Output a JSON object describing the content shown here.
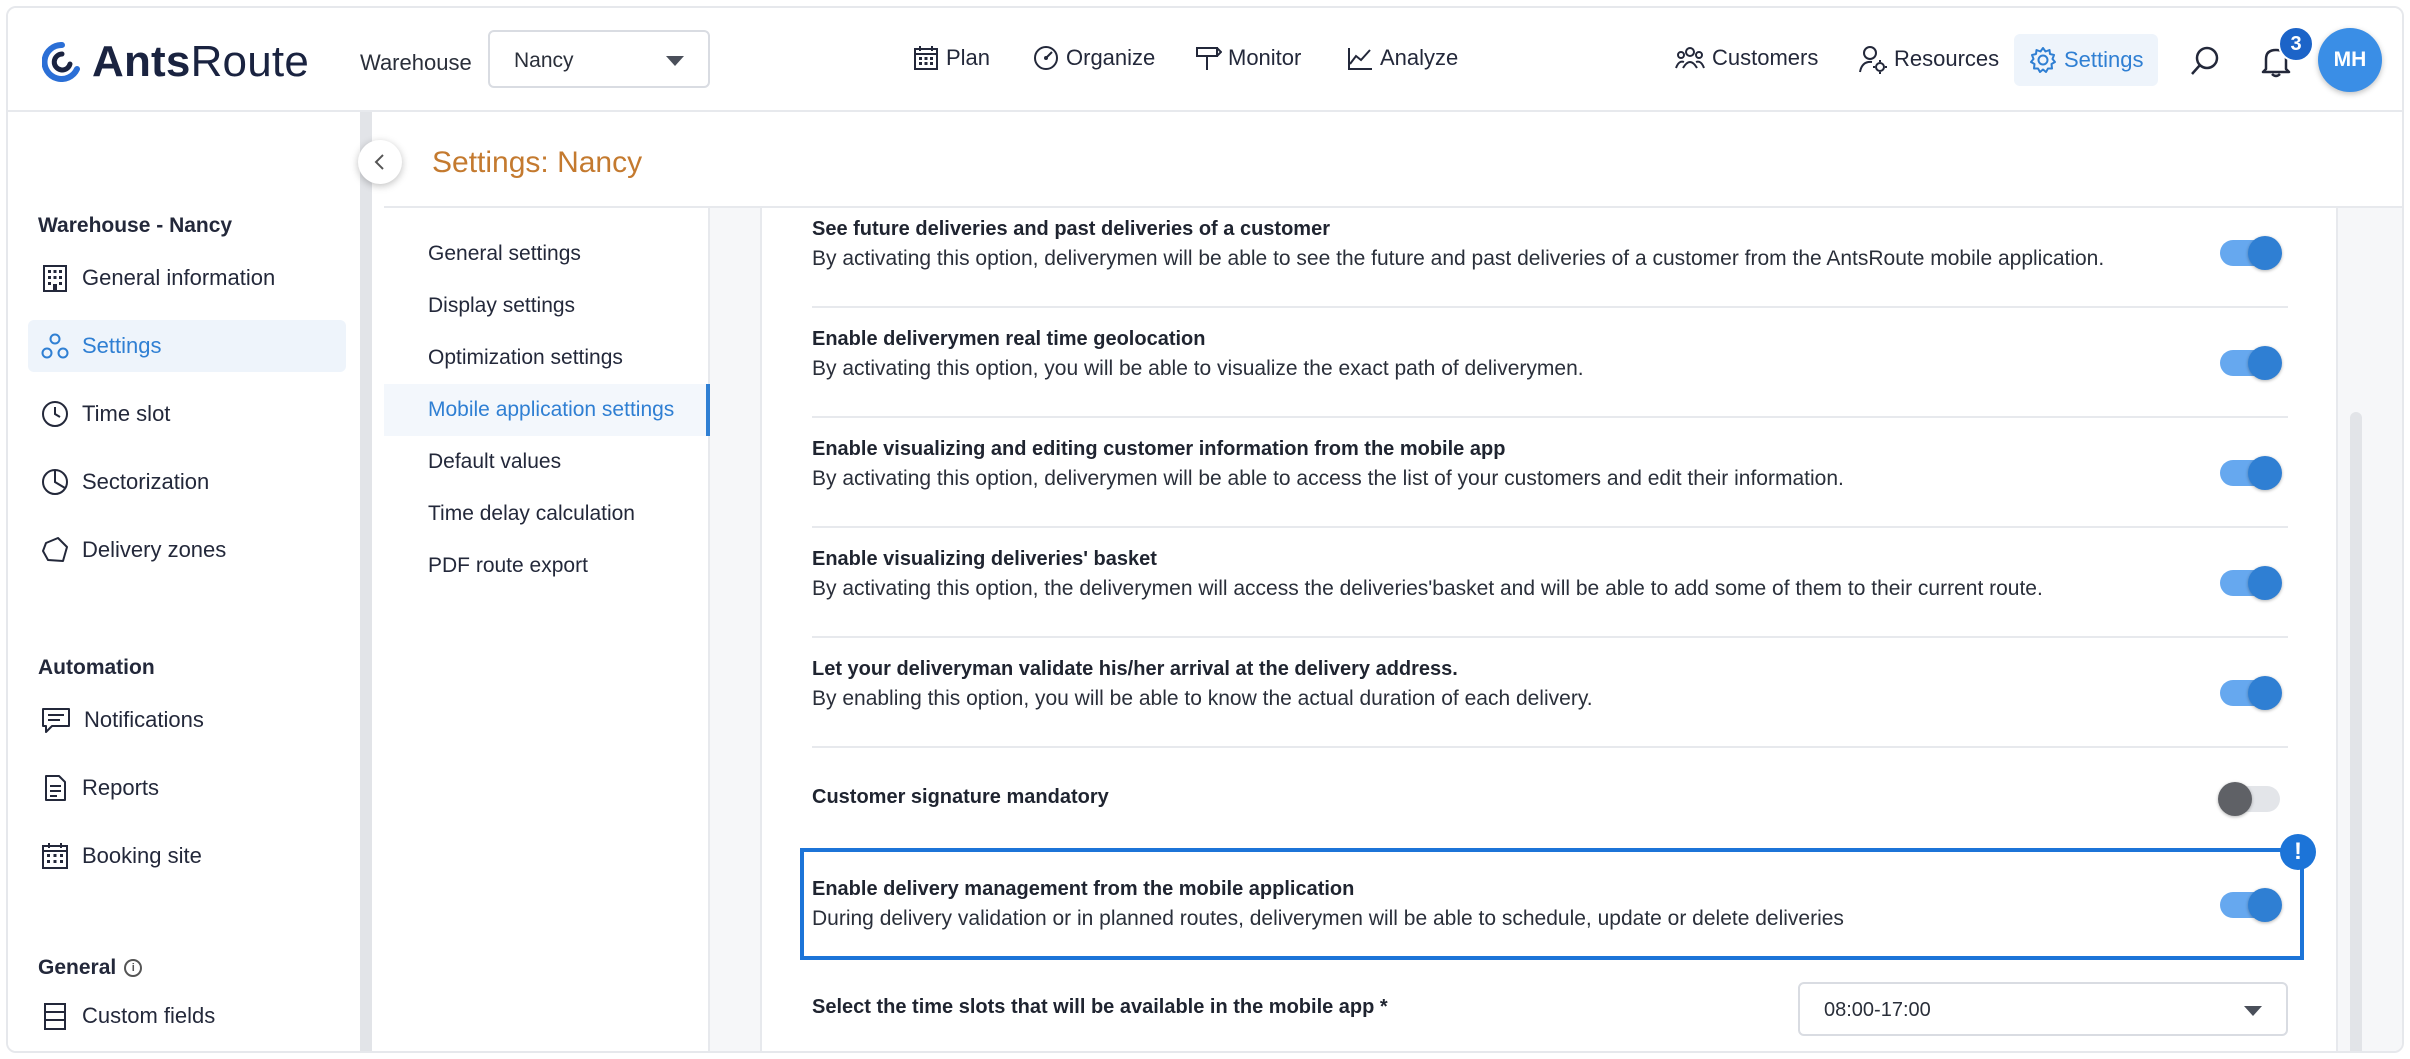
{
  "app": {
    "logo_bold": "Ants",
    "logo_light": "Route",
    "warehouse_label": "Warehouse",
    "warehouse_value": "Nancy"
  },
  "nav": {
    "plan": "Plan",
    "organize": "Organize",
    "monitor": "Monitor",
    "analyze": "Analyze",
    "customers": "Customers",
    "resources": "Resources",
    "settings": "Settings",
    "notification_count": "3",
    "avatar_initials": "MH"
  },
  "sidebar": {
    "section_warehouse": "Warehouse - Nancy",
    "general_information": "General information",
    "settings": "Settings",
    "time_slot": "Time slot",
    "sectorization": "Sectorization",
    "delivery_zones": "Delivery zones",
    "section_automation": "Automation",
    "notifications": "Notifications",
    "reports": "Reports",
    "booking_site": "Booking site",
    "section_general": "General",
    "custom_fields": "Custom fields"
  },
  "page": {
    "title": "Settings: Nancy"
  },
  "submenu": {
    "items": [
      "General settings",
      "Display settings",
      "Optimization settings",
      "Mobile application settings",
      "Default values",
      "Time delay calculation",
      "PDF route export"
    ],
    "active_index": 3
  },
  "options": [
    {
      "title": "See future deliveries and past deliveries of a customer",
      "desc": "By activating this option, deliverymen will be able to see the future and past deliveries of a customer from the AntsRoute mobile application.",
      "enabled": true
    },
    {
      "title": "Enable deliverymen real time geolocation",
      "desc": "By activating this option, you will be able to visualize the exact path of deliverymen.",
      "enabled": true
    },
    {
      "title": "Enable visualizing and editing customer information from the mobile app",
      "desc": "By activating this option, deliverymen will be able to access the list of your customers and edit their information.",
      "enabled": true
    },
    {
      "title": "Enable visualizing deliveries' basket",
      "desc": "By activating this option, the deliverymen will access the deliveries'basket and will be able to add some of them to their current route.",
      "enabled": true
    },
    {
      "title": "Let your deliveryman validate his/her arrival at the delivery address.",
      "desc": "By enabling this option, you will be able to know the actual duration of each delivery.",
      "enabled": true
    },
    {
      "title": "Customer signature mandatory",
      "desc": "",
      "enabled": false
    },
    {
      "title": "Enable delivery management from the mobile application",
      "desc": "During delivery validation or in planned routes, deliverymen will be able to schedule, update or delete deliveries",
      "enabled": true
    }
  ],
  "alert_badge": "!",
  "time_slots": {
    "label": "Select the time slots that will be available in the mobile app *",
    "value": "08:00-17:00"
  },
  "colors": {
    "accent": "#2f7fd3",
    "title": "#c47a2f",
    "highlight": "#1c74d8"
  }
}
